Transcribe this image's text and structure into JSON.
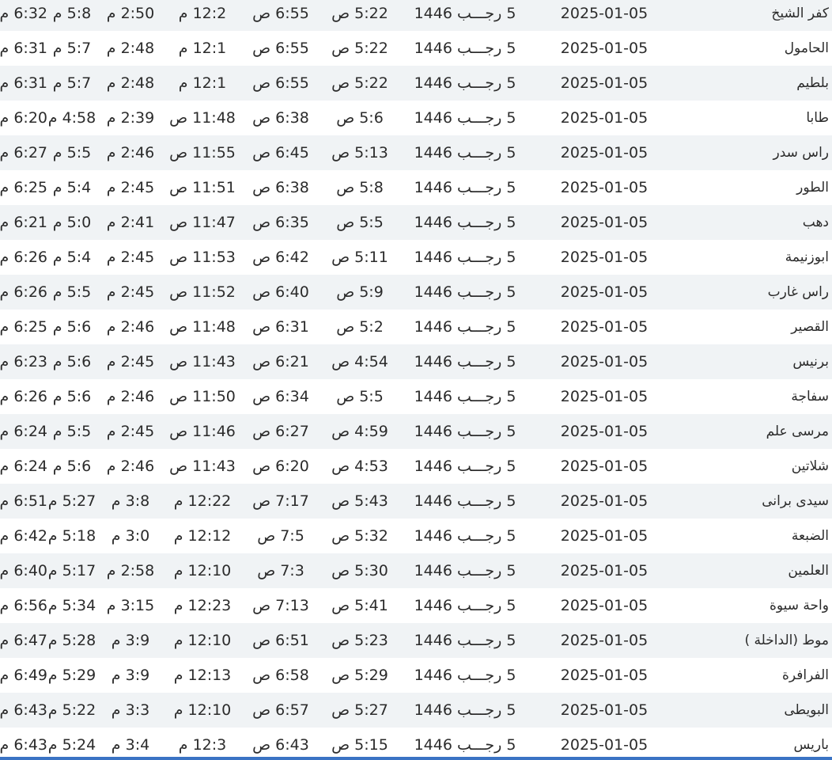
{
  "rows": [
    {
      "city": "كفر الشيخ",
      "gregorian": "2025-01-05",
      "hijri": "5 رجـــب 1446",
      "fajr": "5:22 ص",
      "sunrise": "6:55 ص",
      "dhuhr": "12:2 م",
      "asr": "2:50 م",
      "maghrib": "5:8 م",
      "isha": "6:32 م"
    },
    {
      "city": "الحامول",
      "gregorian": "2025-01-05",
      "hijri": "5 رجـــب 1446",
      "fajr": "5:22 ص",
      "sunrise": "6:55 ص",
      "dhuhr": "12:1 م",
      "asr": "2:48 م",
      "maghrib": "5:7 م",
      "isha": "6:31 م"
    },
    {
      "city": "بلطيم",
      "gregorian": "2025-01-05",
      "hijri": "5 رجـــب 1446",
      "fajr": "5:22 ص",
      "sunrise": "6:55 ص",
      "dhuhr": "12:1 م",
      "asr": "2:48 م",
      "maghrib": "5:7 م",
      "isha": "6:31 م"
    },
    {
      "city": "طابا",
      "gregorian": "2025-01-05",
      "hijri": "5 رجـــب 1446",
      "fajr": "5:6 ص",
      "sunrise": "6:38 ص",
      "dhuhr": "11:48 ص",
      "asr": "2:39 م",
      "maghrib": "4:58 م",
      "isha": "6:20 م"
    },
    {
      "city": "راس سدر",
      "gregorian": "2025-01-05",
      "hijri": "5 رجـــب 1446",
      "fajr": "5:13 ص",
      "sunrise": "6:45 ص",
      "dhuhr": "11:55 ص",
      "asr": "2:46 م",
      "maghrib": "5:5 م",
      "isha": "6:27 م"
    },
    {
      "city": "الطور",
      "gregorian": "2025-01-05",
      "hijri": "5 رجـــب 1446",
      "fajr": "5:8 ص",
      "sunrise": "6:38 ص",
      "dhuhr": "11:51 ص",
      "asr": "2:45 م",
      "maghrib": "5:4 م",
      "isha": "6:25 م"
    },
    {
      "city": "دهب",
      "gregorian": "2025-01-05",
      "hijri": "5 رجـــب 1446",
      "fajr": "5:5 ص",
      "sunrise": "6:35 ص",
      "dhuhr": "11:47 ص",
      "asr": "2:41 م",
      "maghrib": "5:0 م",
      "isha": "6:21 م"
    },
    {
      "city": "ابوزنيمة",
      "gregorian": "2025-01-05",
      "hijri": "5 رجـــب 1446",
      "fajr": "5:11 ص",
      "sunrise": "6:42 ص",
      "dhuhr": "11:53 ص",
      "asr": "2:45 م",
      "maghrib": "5:4 م",
      "isha": "6:26 م"
    },
    {
      "city": "راس غارب",
      "gregorian": "2025-01-05",
      "hijri": "5 رجـــب 1446",
      "fajr": "5:9 ص",
      "sunrise": "6:40 ص",
      "dhuhr": "11:52 ص",
      "asr": "2:45 م",
      "maghrib": "5:5 م",
      "isha": "6:26 م"
    },
    {
      "city": "القصير",
      "gregorian": "2025-01-05",
      "hijri": "5 رجـــب 1446",
      "fajr": "5:2 ص",
      "sunrise": "6:31 ص",
      "dhuhr": "11:48 ص",
      "asr": "2:46 م",
      "maghrib": "5:6 م",
      "isha": "6:25 م"
    },
    {
      "city": "برنيس",
      "gregorian": "2025-01-05",
      "hijri": "5 رجـــب 1446",
      "fajr": "4:54 ص",
      "sunrise": "6:21 ص",
      "dhuhr": "11:43 ص",
      "asr": "2:45 م",
      "maghrib": "5:6 م",
      "isha": "6:23 م"
    },
    {
      "city": "سفاجة",
      "gregorian": "2025-01-05",
      "hijri": "5 رجـــب 1446",
      "fajr": "5:5 ص",
      "sunrise": "6:34 ص",
      "dhuhr": "11:50 ص",
      "asr": "2:46 م",
      "maghrib": "5:6 م",
      "isha": "6:26 م"
    },
    {
      "city": "مرسى علم",
      "gregorian": "2025-01-05",
      "hijri": "5 رجـــب 1446",
      "fajr": "4:59 ص",
      "sunrise": "6:27 ص",
      "dhuhr": "11:46 ص",
      "asr": "2:45 م",
      "maghrib": "5:5 م",
      "isha": "6:24 م"
    },
    {
      "city": "شلاتين",
      "gregorian": "2025-01-05",
      "hijri": "5 رجـــب 1446",
      "fajr": "4:53 ص",
      "sunrise": "6:20 ص",
      "dhuhr": "11:43 ص",
      "asr": "2:46 م",
      "maghrib": "5:6 م",
      "isha": "6:24 م"
    },
    {
      "city": "سيدى برانى",
      "gregorian": "2025-01-05",
      "hijri": "5 رجـــب 1446",
      "fajr": "5:43 ص",
      "sunrise": "7:17 ص",
      "dhuhr": "12:22 م",
      "asr": "3:8 م",
      "maghrib": "5:27 م",
      "isha": "6:51 م"
    },
    {
      "city": "الضبعة",
      "gregorian": "2025-01-05",
      "hijri": "5 رجـــب 1446",
      "fajr": "5:32 ص",
      "sunrise": "7:5 ص",
      "dhuhr": "12:12 م",
      "asr": "3:0 م",
      "maghrib": "5:18 م",
      "isha": "6:42 م"
    },
    {
      "city": "العلمين",
      "gregorian": "2025-01-05",
      "hijri": "5 رجـــب 1446",
      "fajr": "5:30 ص",
      "sunrise": "7:3 ص",
      "dhuhr": "12:10 م",
      "asr": "2:58 م",
      "maghrib": "5:17 م",
      "isha": "6:40 م"
    },
    {
      "city": "واحة سيوة",
      "gregorian": "2025-01-05",
      "hijri": "5 رجـــب 1446",
      "fajr": "5:41 ص",
      "sunrise": "7:13 ص",
      "dhuhr": "12:23 م",
      "asr": "3:15 م",
      "maghrib": "5:34 م",
      "isha": "6:56 م"
    },
    {
      "city": "موط (الداخلة )",
      "gregorian": "2025-01-05",
      "hijri": "5 رجـــب 1446",
      "fajr": "5:23 ص",
      "sunrise": "6:51 ص",
      "dhuhr": "12:10 م",
      "asr": "3:9 م",
      "maghrib": "5:28 م",
      "isha": "6:47 م"
    },
    {
      "city": "الفرافرة",
      "gregorian": "2025-01-05",
      "hijri": "5 رجـــب 1446",
      "fajr": "5:29 ص",
      "sunrise": "6:58 ص",
      "dhuhr": "12:13 م",
      "asr": "3:9 م",
      "maghrib": "5:29 م",
      "isha": "6:49 م"
    },
    {
      "city": "البويطى",
      "gregorian": "2025-01-05",
      "hijri": "5 رجـــب 1446",
      "fajr": "5:27 ص",
      "sunrise": "6:57 ص",
      "dhuhr": "12:10 م",
      "asr": "3:3 م",
      "maghrib": "5:22 م",
      "isha": "6:43 م"
    },
    {
      "city": "باريس",
      "gregorian": "2025-01-05",
      "hijri": "5 رجـــب 1446",
      "fajr": "5:15 ص",
      "sunrise": "6:43 ص",
      "dhuhr": "12:3 م",
      "asr": "3:4 م",
      "maghrib": "5:24 م",
      "isha": "6:43 م"
    }
  ]
}
